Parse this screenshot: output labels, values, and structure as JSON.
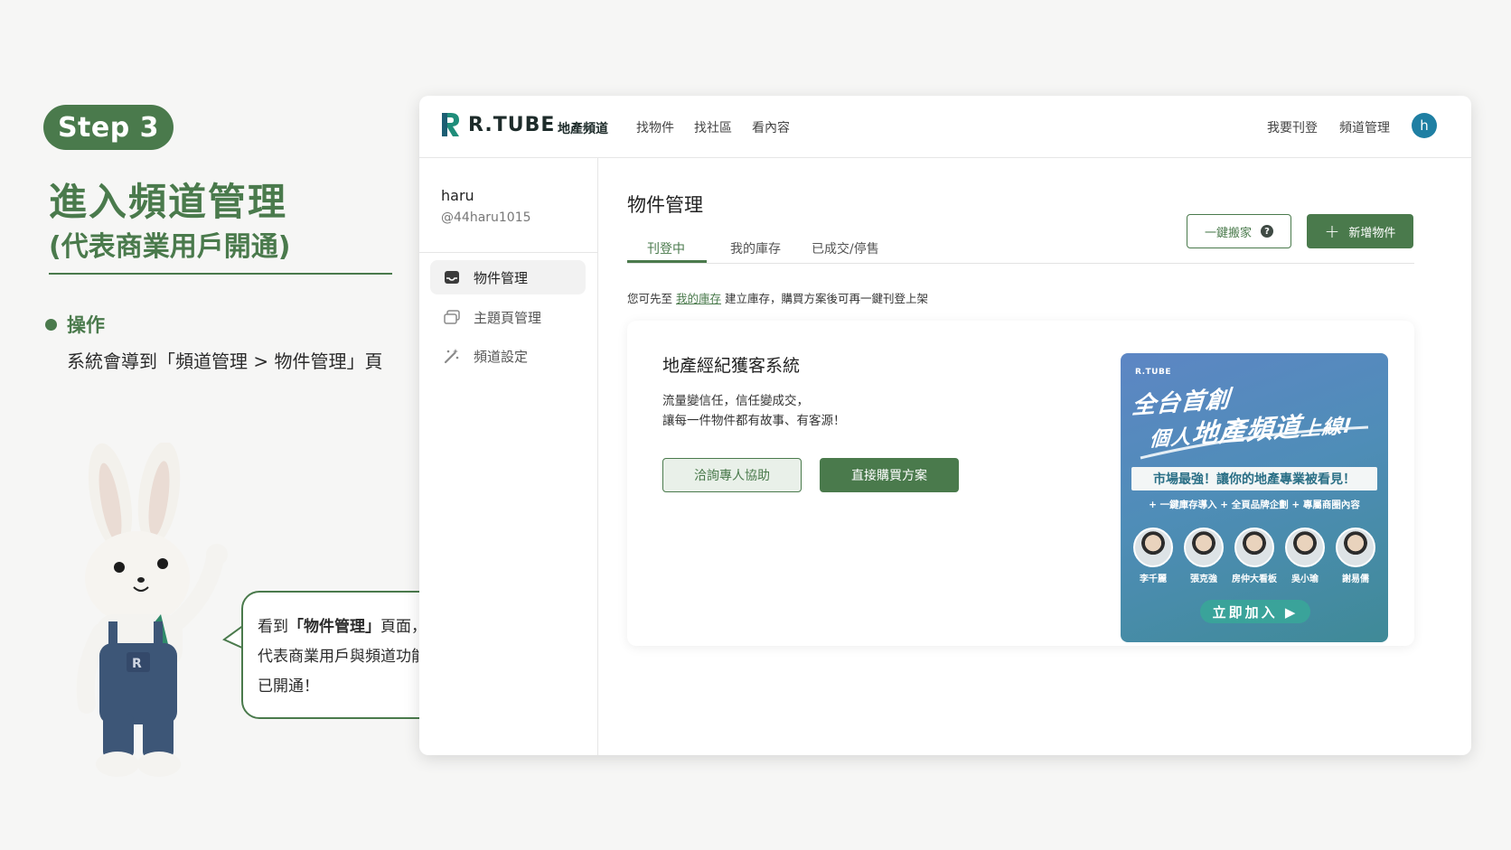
{
  "tutorial": {
    "step_label": "Step 3",
    "title": "進入頻道管理",
    "subtitle": "(代表商業用戶開通)",
    "operation_label": "操作",
    "operation_desc": "系統會導到「頻道管理 > 物件管理」頁",
    "bubble_line1_prefix": "看到",
    "bubble_line1_bold": "「物件管理」",
    "bubble_line1_suffix": "頁面，",
    "bubble_line2": "代表商業用戶與頻道功能",
    "bubble_line3": "已開通！",
    "accent_color": "#4a7a4c"
  },
  "header": {
    "logo_text": "R.TUBE",
    "logo_sub": "地產頻道",
    "nav": [
      "找物件",
      "找社區",
      "看內容"
    ],
    "right_nav": [
      "我要刊登",
      "頻道管理"
    ],
    "avatar_initial": "h"
  },
  "sidebar": {
    "user_name": "haru",
    "user_handle": "@44haru1015",
    "items": [
      {
        "label": "物件管理",
        "icon": "inbox-icon",
        "active": true
      },
      {
        "label": "主題頁管理",
        "icon": "layers-icon",
        "active": false
      },
      {
        "label": "頻道設定",
        "icon": "magic-wand-icon",
        "active": false
      }
    ]
  },
  "main": {
    "page_title": "物件管理",
    "tabs": [
      {
        "label": "刊登中",
        "active": true
      },
      {
        "label": "我的庫存",
        "active": false
      },
      {
        "label": "已成交/停售",
        "active": false
      }
    ],
    "import_button": "一鍵搬家",
    "add_button": "新增物件",
    "hint_prefix": "您可先至",
    "hint_link": "我的庫存",
    "hint_suffix": "建立庫存，購買方案後可再一鍵刊登上架"
  },
  "promo": {
    "title": "地產經紀獲客系統",
    "desc_line1": "流量變信任，信任變成交，",
    "desc_line2": "讓每一件物件都有故事、有客源！",
    "consult_button": "洽詢專人協助",
    "buy_button": "直接購買方案"
  },
  "banner": {
    "brand": "R.TUBE",
    "headline1": "全台首創",
    "headline2_a": "個人",
    "headline2_b": "地產頻道",
    "headline2_c": "上線!",
    "tagline": "市場最強！讓你的地產專業被看見！",
    "features": "+ 一鍵庫存導入 + 全頁品牌企劃 + 專屬商圈內容",
    "people": [
      "李千麗",
      "張克強",
      "房仲大看板",
      "吳小瑜",
      "謝易儒"
    ],
    "cta": "立即加入 ▶"
  }
}
